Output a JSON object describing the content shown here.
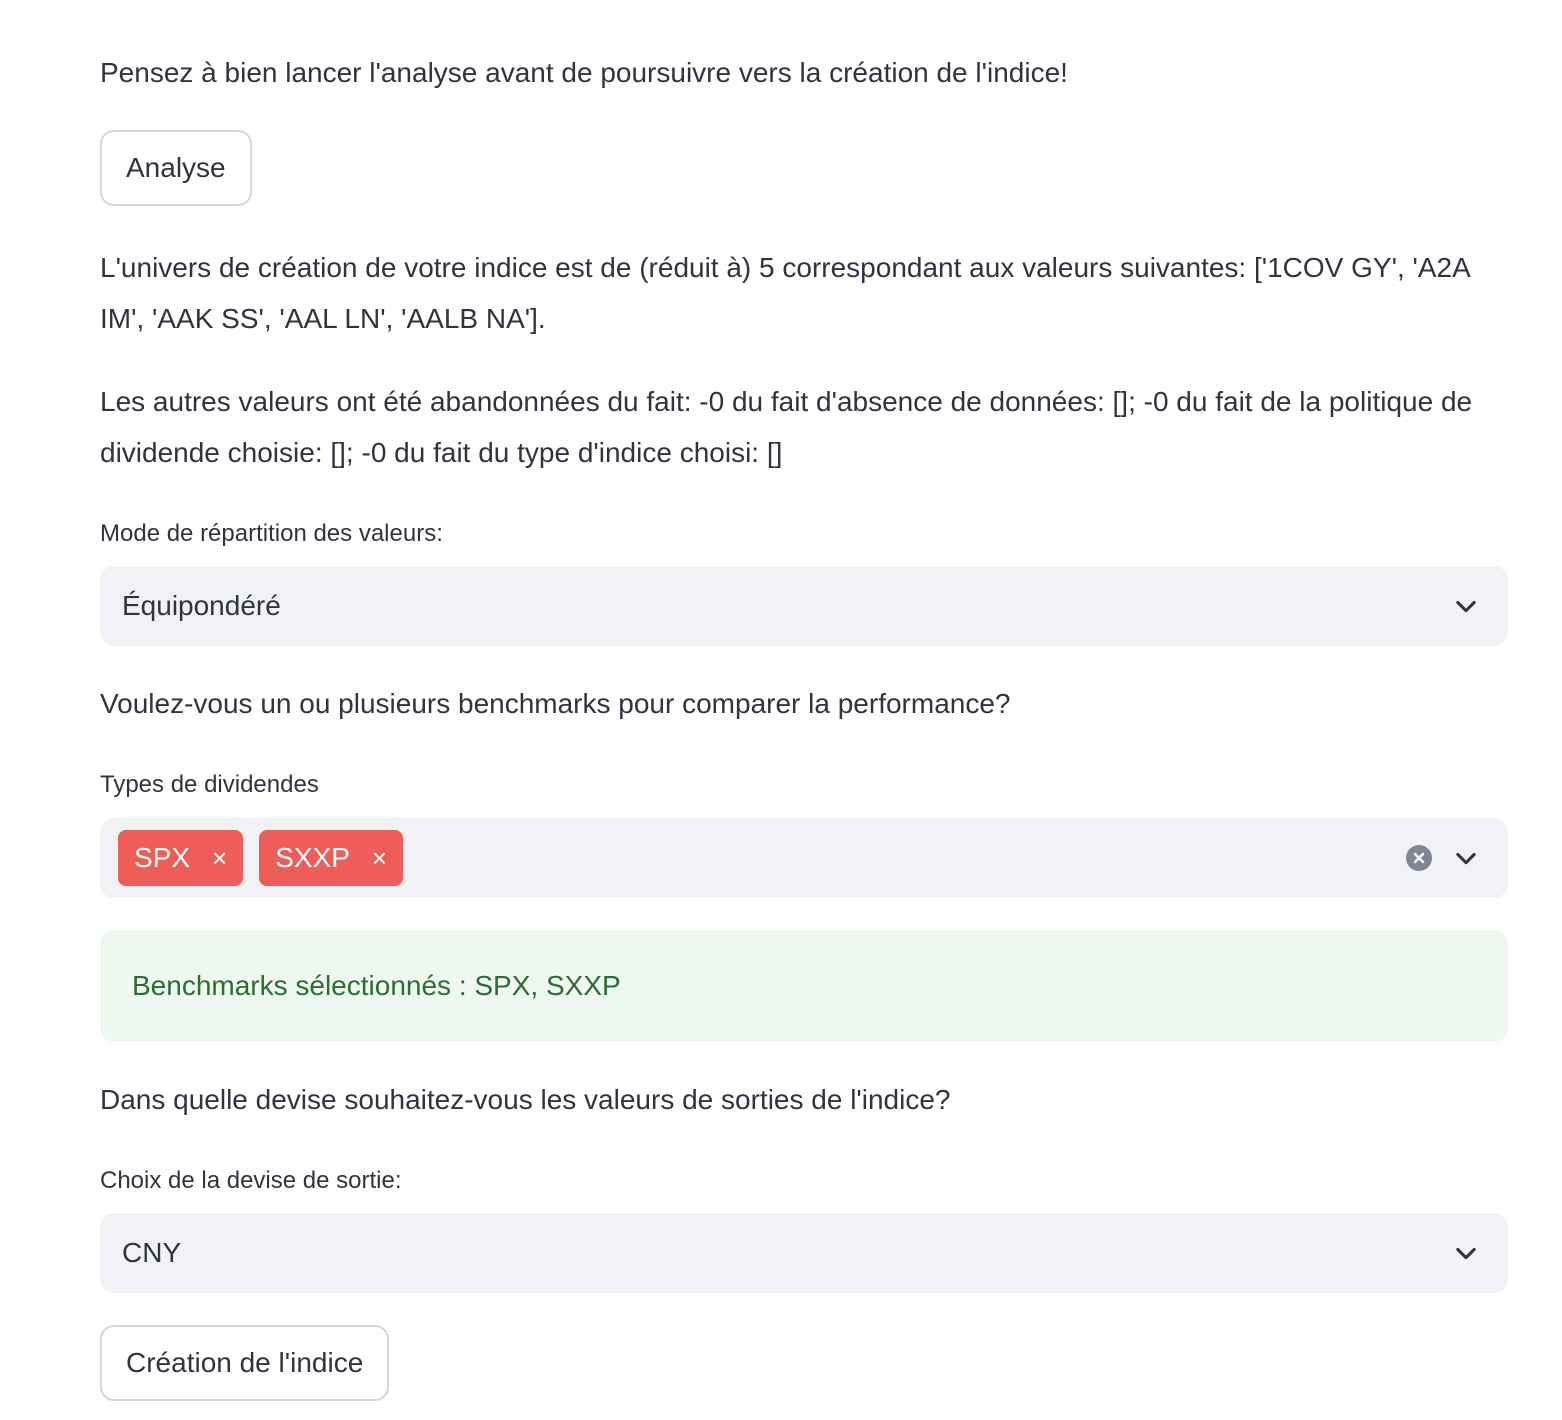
{
  "intro": {
    "text": "Pensez à bien lancer l'analyse avant de poursuivre vers la création de l'indice!"
  },
  "analyse_button": {
    "label": "Analyse"
  },
  "universe": {
    "text": "L'univers de création de votre indice est de (réduit à) 5 correspondant aux valeurs suivantes: ['1COV GY', 'A2A IM', 'AAK SS', 'AAL LN', 'AALB NA']."
  },
  "dropped": {
    "text": "Les autres valeurs ont été abandonnées du fait: -0 du fait d'absence de données: []; -0 du fait de la politique de dividende choisie: []; -0 du fait du type d'indice choisi: []"
  },
  "weighting": {
    "label": "Mode de répartition des valeurs:",
    "selected": "Équipondéré"
  },
  "benchmark_question": {
    "text": "Voulez-vous un ou plusieurs benchmarks pour comparer la performance?"
  },
  "dividends": {
    "label": "Types de dividendes",
    "tags": [
      "SPX",
      "SXXP"
    ],
    "tag_remove_glyph": "×"
  },
  "benchmark_alert": {
    "text": "Benchmarks sélectionnés : SPX, SXXP"
  },
  "currency_question": {
    "text": "Dans quelle devise souhaitez-vous les valeurs de sorties de l'indice?"
  },
  "currency": {
    "label": "Choix de la devise de sortie:",
    "selected": "CNY"
  },
  "create_button": {
    "label": "Création de l'indice"
  },
  "icons": {
    "chevron": "chevron-down-icon",
    "clear": "clear-all-icon"
  },
  "colors": {
    "tag_bg": "#ee5d58",
    "alert_bg": "#eef8f0",
    "alert_text": "#2c6e32",
    "select_bg": "#f0f2f6",
    "text": "#31333f"
  }
}
